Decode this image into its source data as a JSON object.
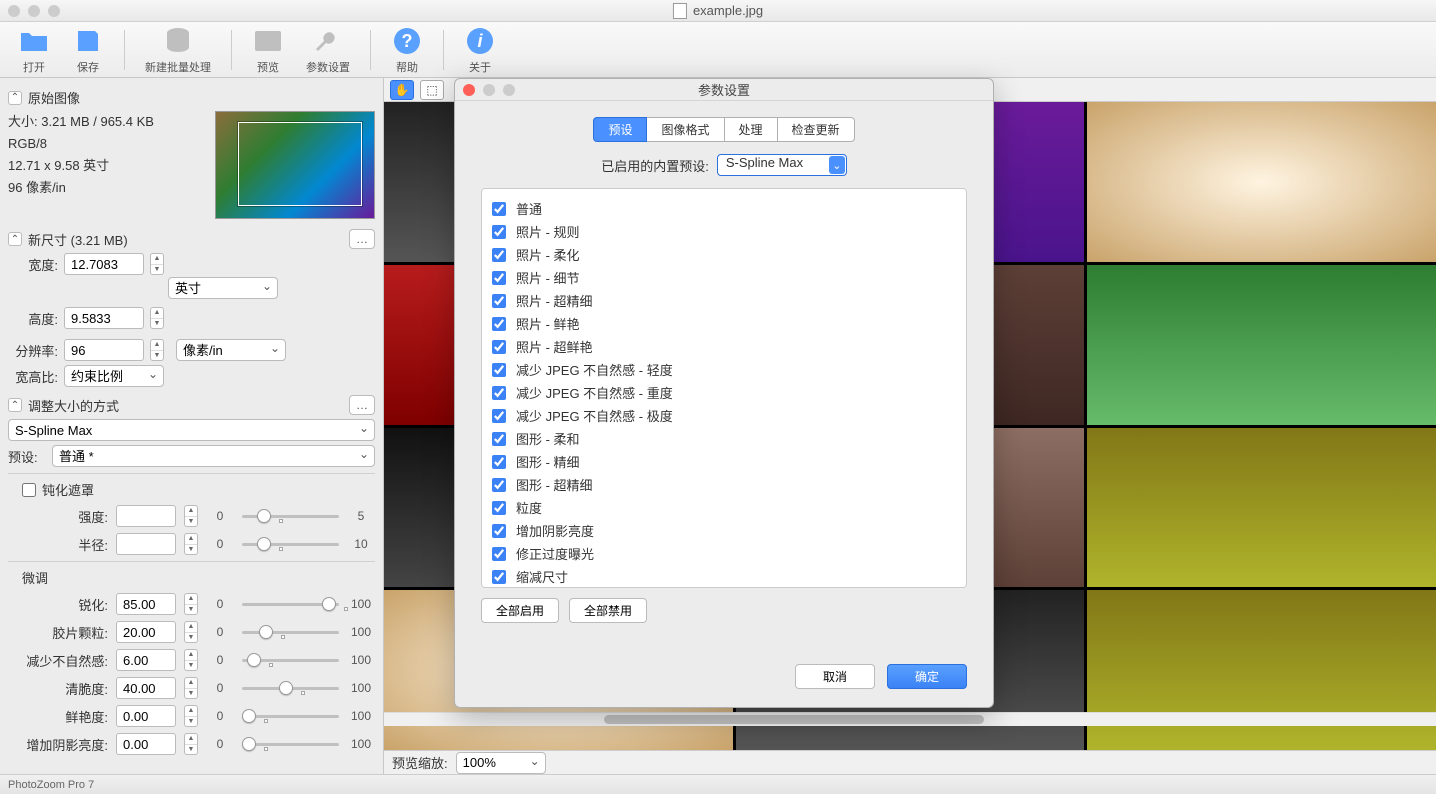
{
  "window": {
    "title": "example.jpg"
  },
  "toolbar": {
    "open": "打开",
    "save": "保存",
    "new_batch": "新建批量处理",
    "preview": "预览",
    "params": "参数设置",
    "help": "帮助",
    "about": "关于"
  },
  "sidebar": {
    "original": {
      "header": "原始图像",
      "size": "大小: 3.21 MB / 965.4 KB",
      "mode": "RGB/8",
      "dims": "12.71 x 9.58 英寸",
      "res": "96 像素/in"
    },
    "new_size": {
      "header": "新尺寸 (3.21 MB)",
      "width_label": "宽度:",
      "width": "12.7083",
      "height_label": "高度:",
      "height": "9.5833",
      "unit": "英寸",
      "res_label": "分辨率:",
      "res": "96",
      "res_unit": "像素/in",
      "aspect_label": "宽高比:",
      "aspect": "约束比例"
    },
    "resize_method": {
      "header": "调整大小的方式",
      "method": "S-Spline Max",
      "preset_label": "预设:",
      "preset": "普通 *"
    },
    "unsharp": {
      "label": "钝化遮罩",
      "strength_label": "强度:",
      "strength": "",
      "radius_label": "半径:",
      "radius": "",
      "min": "0",
      "max_strength": "5",
      "max_radius": "10"
    },
    "finetune": {
      "header": "微调",
      "sharpen_label": "锐化:",
      "sharpen": "85.00",
      "grain_label": "胶片颗粒:",
      "grain": "20.00",
      "artifact_label": "减少不自然感:",
      "artifact": "6.00",
      "crisp_label": "清脆度:",
      "crisp": "40.00",
      "vivid_label": "鲜艳度:",
      "vivid": "0.00",
      "shadow_label": "增加阴影亮度:",
      "shadow": "0.00",
      "min": "0",
      "max": "100"
    }
  },
  "canvas": {
    "zoom_label": "预览缩放:",
    "zoom": "100%"
  },
  "status": {
    "app": "PhotoZoom Pro 7"
  },
  "modal": {
    "title": "参数设置",
    "tabs": {
      "preset": "预设",
      "format": "图像格式",
      "process": "处理",
      "update": "检查更新"
    },
    "preset_enabled_label": "已启用的内置预设:",
    "preset_enabled": "S-Spline Max",
    "items": [
      "普通",
      "照片 - 规则",
      "照片 - 柔化",
      "照片 - 细节",
      "照片 - 超精细",
      "照片 - 鲜艳",
      "照片 - 超鲜艳",
      "减少 JPEG 不自然感 - 轻度",
      "减少 JPEG 不自然感 - 重度",
      "减少 JPEG 不自然感 - 极度",
      "图形 - 柔和",
      "图形 - 精细",
      "图形 - 超精细",
      "粒度",
      "增加阴影亮度",
      "修正过度曝光",
      "缩减尺寸"
    ],
    "enable_all": "全部启用",
    "disable_all": "全部禁用",
    "cancel": "取消",
    "ok": "确定"
  }
}
